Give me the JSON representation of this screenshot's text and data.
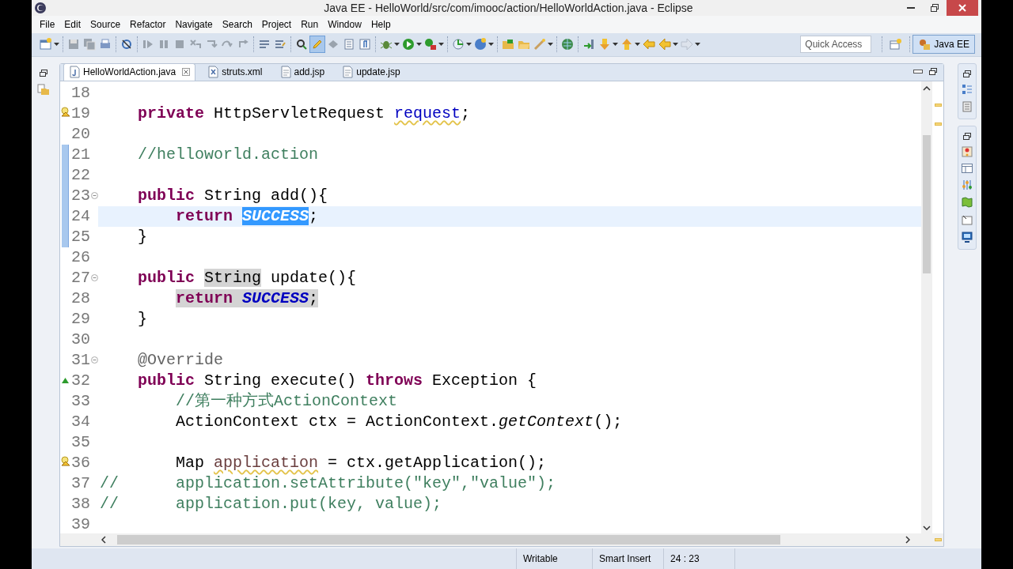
{
  "window": {
    "title": "Java EE - HelloWorld/src/com/imooc/action/HelloWorldAction.java - Eclipse"
  },
  "menu": [
    "File",
    "Edit",
    "Source",
    "Refactor",
    "Navigate",
    "Search",
    "Project",
    "Run",
    "Window",
    "Help"
  ],
  "toolbar": {
    "highlight_toggle_on": true,
    "quick_access": {
      "placeholder": "Quick Access"
    },
    "perspective": {
      "label": "Java EE",
      "selected": true
    }
  },
  "tabs": [
    {
      "label": "HelloWorldAction.java",
      "kind": "java",
      "selected": true
    },
    {
      "label": "struts.xml",
      "kind": "xml",
      "selected": false
    },
    {
      "label": "add.jsp",
      "kind": "jsp",
      "selected": false
    },
    {
      "label": "update.jsp",
      "kind": "jsp",
      "selected": false
    }
  ],
  "editor": {
    "lines": [
      {
        "number": "18",
        "current": false,
        "changed": false
      },
      {
        "number": "19",
        "current": false,
        "changed": false,
        "gutter": {
          "kind": "warning"
        },
        "tokens": [
          {
            "text": "    private ",
            "kind": "keyword"
          },
          {
            "text": "HttpServletRequest ",
            "kind": "plain"
          },
          {
            "text": "request",
            "kind": "field-warning"
          },
          {
            "text": ";",
            "kind": "plain"
          }
        ]
      },
      {
        "number": "20",
        "current": false,
        "changed": false
      },
      {
        "number": "21",
        "current": false,
        "changed": true,
        "tokens": [
          {
            "text": "    //helloworld.action",
            "kind": "comment"
          }
        ]
      },
      {
        "number": "22",
        "current": false,
        "changed": true
      },
      {
        "number": "23",
        "current": false,
        "changed": true,
        "gutter": {
          "kind": "fold"
        },
        "tokens": [
          {
            "text": "    public ",
            "kind": "keyword"
          },
          {
            "text": "String add(){",
            "kind": "plain"
          }
        ]
      },
      {
        "number": "24",
        "current": true,
        "changed": true,
        "tokens": [
          {
            "text": "        return ",
            "kind": "keyword"
          },
          {
            "text": "SUCCESS",
            "kind": "constant",
            "highlight": {
              "kind": "selection"
            }
          },
          {
            "text": ";",
            "kind": "plain"
          }
        ]
      },
      {
        "number": "25",
        "current": false,
        "changed": true,
        "tokens": [
          {
            "text": "    }",
            "kind": "plain"
          }
        ]
      },
      {
        "number": "26",
        "current": false,
        "changed": false
      },
      {
        "number": "27",
        "current": false,
        "changed": false,
        "gutter": {
          "kind": "fold"
        },
        "tokens": [
          {
            "text": "    public ",
            "kind": "keyword"
          },
          {
            "text": "String",
            "kind": "plain",
            "highlight": {
              "kind": "occurrence"
            }
          },
          {
            "text": " update(){",
            "kind": "plain"
          }
        ]
      },
      {
        "number": "28",
        "current": false,
        "changed": false,
        "tokens": [
          {
            "text": "        return ",
            "kind": "keyword",
            "highlight": {
              "kind": "occurrence"
            }
          },
          {
            "text": "SUCCESS",
            "kind": "constant",
            "highlight": {
              "kind": "occurrence"
            }
          },
          {
            "text": ";",
            "kind": "plain",
            "highlight": {
              "kind": "occurrence"
            }
          }
        ]
      },
      {
        "number": "29",
        "current": false,
        "changed": false,
        "tokens": [
          {
            "text": "    }",
            "kind": "plain"
          }
        ]
      },
      {
        "number": "30",
        "current": false,
        "changed": false
      },
      {
        "number": "31",
        "current": false,
        "changed": false,
        "gutter": {
          "kind": "fold"
        },
        "tokens": [
          {
            "text": "    @Override",
            "kind": "annotation"
          }
        ]
      },
      {
        "number": "32",
        "current": false,
        "changed": false,
        "gutter": {
          "kind": "override"
        },
        "tokens": [
          {
            "text": "    public ",
            "kind": "keyword"
          },
          {
            "text": "String execute() ",
            "kind": "plain"
          },
          {
            "text": "throws ",
            "kind": "keyword"
          },
          {
            "text": "Exception {",
            "kind": "plain"
          }
        ]
      },
      {
        "number": "33",
        "current": false,
        "changed": false,
        "tokens": [
          {
            "text": "        //第一种方式ActionContext",
            "kind": "comment"
          }
        ]
      },
      {
        "number": "34",
        "current": false,
        "changed": false,
        "tokens": [
          {
            "text": "        ActionContext ctx = ActionContext.",
            "kind": "plain"
          },
          {
            "text": "getContext",
            "kind": "static-call"
          },
          {
            "text": "();",
            "kind": "plain"
          }
        ]
      },
      {
        "number": "35",
        "current": false,
        "changed": false
      },
      {
        "number": "36",
        "current": false,
        "changed": false,
        "gutter": {
          "kind": "warning"
        },
        "tokens": [
          {
            "text": "        Map ",
            "kind": "plain"
          },
          {
            "text": "application",
            "kind": "local-warning"
          },
          {
            "text": " = ctx.getApplication();",
            "kind": "plain"
          }
        ]
      },
      {
        "number": "37",
        "current": false,
        "changed": false,
        "tokens": [
          {
            "text": "//      application.setAttribute(\"key\",\"value\");",
            "kind": "comment"
          }
        ]
      },
      {
        "number": "38",
        "current": false,
        "changed": false,
        "tokens": [
          {
            "text": "//      application.put(key, value);",
            "kind": "comment"
          }
        ]
      },
      {
        "number": "39",
        "current": false,
        "changed": false
      }
    ]
  },
  "status_bar": [
    "Writable",
    "Smart Insert",
    "24 : 23"
  ]
}
